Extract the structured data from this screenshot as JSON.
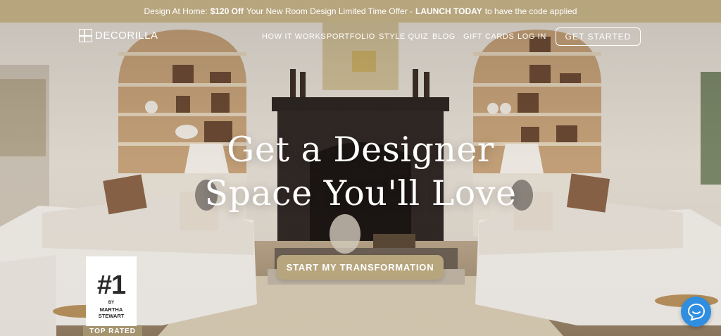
{
  "promo": {
    "lead": "Design At Home:",
    "offer": "$120 Off",
    "middle": "Your New Room Design Limited Time Offer -",
    "launch": "LAUNCH TODAY",
    "tail": "to have the code applied"
  },
  "brand": {
    "name": "DECORILLA",
    "logo_icon": "decorilla-logo-icon"
  },
  "nav": {
    "items": [
      {
        "label": "HOW IT WORKS"
      },
      {
        "label": "PORTFOLIO"
      },
      {
        "label": "STYLE QUIZ"
      },
      {
        "label": "BLOG"
      },
      {
        "label": "GIFT CARDS"
      },
      {
        "label": "LOG IN"
      }
    ],
    "cta": "GET STARTED"
  },
  "hero": {
    "headline_line1": "Get a Designer",
    "headline_line2": "Space You'll Love",
    "cta": "START MY TRANSFORMATION"
  },
  "badge": {
    "rank": "#1",
    "by": "BY",
    "name_line1": "MARTHA",
    "name_line2": "STEWART",
    "band": "TOP RATED"
  },
  "chat": {
    "icon": "chat-bubble-icon"
  },
  "colors": {
    "accent": "#b7a57e",
    "chat": "#2f8ee0"
  }
}
